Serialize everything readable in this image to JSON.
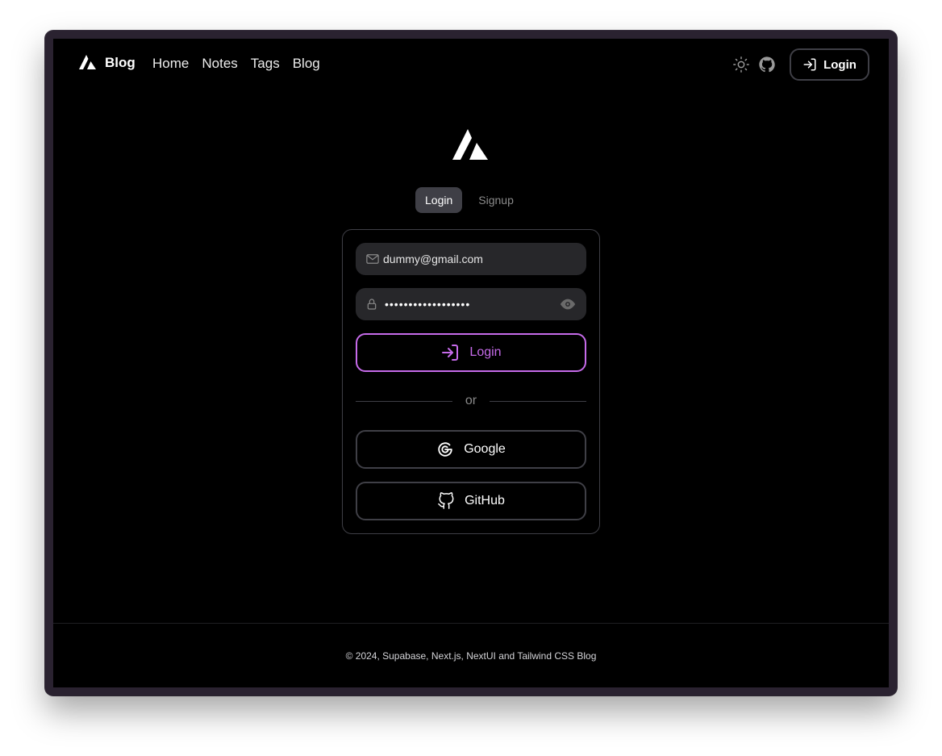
{
  "nav": {
    "brand": "Blog",
    "links": [
      "Home",
      "Notes",
      "Tags",
      "Blog"
    ],
    "login_label": "Login"
  },
  "tabs": [
    {
      "label": "Login",
      "active": true
    },
    {
      "label": "Signup",
      "active": false
    }
  ],
  "form": {
    "email_value": "dummy@gmail.com",
    "password_mask": "••••••••••••••••••",
    "login_button": "Login",
    "divider": "or",
    "google_button": "Google",
    "github_button": "GitHub"
  },
  "footer": {
    "text": "© 2024, Supabase, Next.js, NextUI and Tailwind CSS Blog"
  },
  "colors": {
    "accent": "#c66bea",
    "background": "#000000",
    "border": "#3f3f46"
  },
  "icons": [
    "logo-icon",
    "sun-icon",
    "github-icon",
    "login-icon",
    "mail-icon",
    "lock-icon",
    "eye-icon",
    "google-icon"
  ]
}
